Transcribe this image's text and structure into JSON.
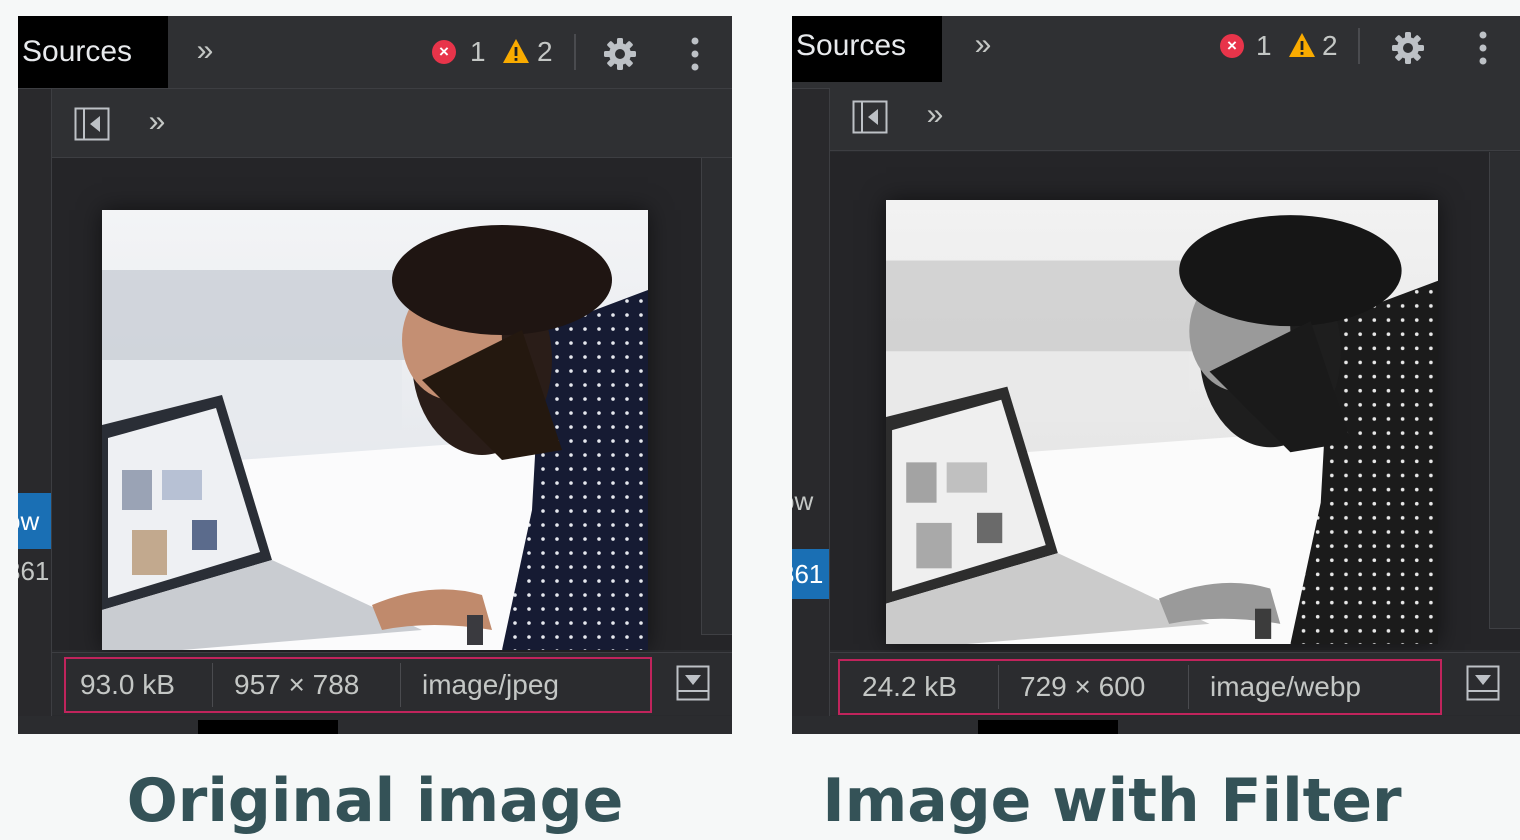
{
  "panels": [
    {
      "tab_label": "Sources",
      "more_tabs": "»",
      "errors": "1",
      "warnings": "2",
      "sub_more": "»",
      "left_strip_selected": "ow",
      "left_strip_text": "361",
      "image": {
        "size": "93.0 kB",
        "dimensions": "957 × 788",
        "mime": "image/jpeg",
        "filter": "none"
      },
      "caption": "Original image"
    },
    {
      "tab_label": "Sources",
      "more_tabs": "»",
      "errors": "1",
      "warnings": "2",
      "sub_more": "»",
      "left_strip_selected": "ow",
      "left_strip_text": "361",
      "image": {
        "size": "24.2 kB",
        "dimensions": "729 × 600",
        "mime": "image/webp",
        "filter": "grayscale"
      },
      "caption": "Image with Filter"
    }
  ],
  "colors": {
    "page_bg": "#f6f8f8",
    "panel_bg": "#292a2d",
    "error": "#e8344a",
    "warning": "#f9ab00",
    "highlight_border": "#c0245c",
    "selection": "#1a6fb4",
    "caption": "#345257"
  },
  "icons": [
    "error-icon",
    "warning-icon",
    "gear-icon",
    "kebab-menu-icon",
    "sidebar-toggle-icon",
    "download-icon"
  ]
}
